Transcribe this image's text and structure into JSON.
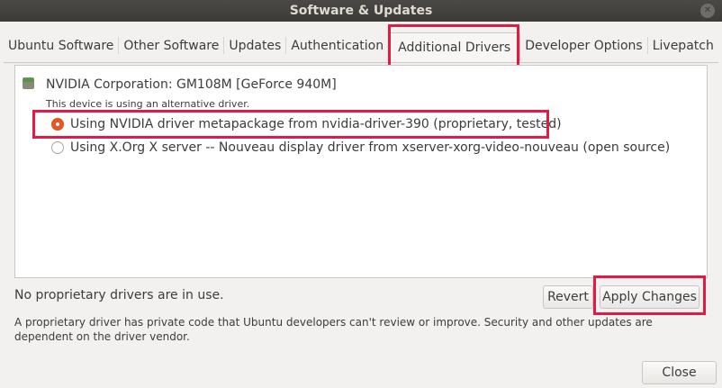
{
  "window": {
    "title": "Software & Updates",
    "close_icon": "close-icon"
  },
  "tabs": [
    {
      "label": "Ubuntu Software",
      "active": false
    },
    {
      "label": "Other Software",
      "active": false
    },
    {
      "label": "Updates",
      "active": false
    },
    {
      "label": "Authentication",
      "active": false
    },
    {
      "label": "Additional Drivers",
      "active": true
    },
    {
      "label": "Developer Options",
      "active": false
    },
    {
      "label": "Livepatch",
      "active": false
    }
  ],
  "device": {
    "icon": "gpu-device-icon",
    "name": "NVIDIA Corporation: GM108M [GeForce 940M]",
    "note": "This device is using an alternative driver.",
    "options": [
      {
        "label": "Using NVIDIA driver metapackage from nvidia-driver-390 (proprietary, tested)",
        "selected": true
      },
      {
        "label": "Using X.Org X server -- Nouveau display driver from xserver-xorg-video-nouveau (open source)",
        "selected": false
      }
    ]
  },
  "status_text": "No proprietary drivers are in use.",
  "buttons": {
    "revert": "Revert",
    "apply": "Apply Changes",
    "close": "Close"
  },
  "footnote": "A proprietary driver has private code that Ubuntu developers can't review or improve. Security and other updates are dependent on the driver vendor.",
  "colors": {
    "highlight": "#e11b45",
    "accent": "#e95420",
    "titlebar": "#3c3b37"
  }
}
